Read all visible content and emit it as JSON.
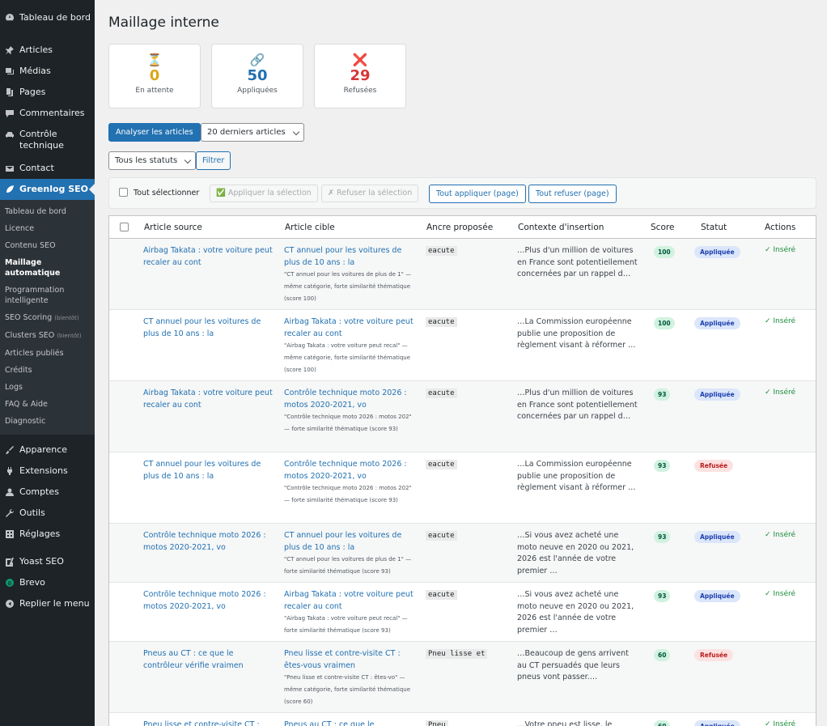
{
  "sidebar": {
    "items_top": [
      {
        "label": "Tableau de bord",
        "icon": "dashboard-icon"
      },
      {
        "label": "Articles",
        "icon": "pin-icon"
      },
      {
        "label": "Médias",
        "icon": "media-icon"
      },
      {
        "label": "Pages",
        "icon": "page-icon"
      },
      {
        "label": "Commentaires",
        "icon": "comment-icon"
      },
      {
        "label": "Contrôle technique",
        "icon": "car-icon"
      },
      {
        "label": "Contact",
        "icon": "mail-icon"
      },
      {
        "label": "Greenlog SEO",
        "icon": "leaf-icon"
      }
    ],
    "submenu": [
      {
        "label": "Tableau de bord",
        "soon": ""
      },
      {
        "label": "Licence",
        "soon": ""
      },
      {
        "label": "Contenu SEO",
        "soon": ""
      },
      {
        "label": "Maillage automatique",
        "soon": ""
      },
      {
        "label": "Programmation intelligente",
        "soon": ""
      },
      {
        "label": "SEO Scoring",
        "soon": "(bientôt)"
      },
      {
        "label": "Clusters SEO",
        "soon": "(bientôt)"
      },
      {
        "label": "Articles publiés",
        "soon": ""
      },
      {
        "label": "Crédits",
        "soon": ""
      },
      {
        "label": "Logs",
        "soon": ""
      },
      {
        "label": "FAQ & Aide",
        "soon": ""
      },
      {
        "label": "Diagnostic",
        "soon": ""
      }
    ],
    "items_bottom": [
      {
        "label": "Apparence",
        "icon": "brush-icon"
      },
      {
        "label": "Extensions",
        "icon": "plugin-icon"
      },
      {
        "label": "Comptes",
        "icon": "user-icon"
      },
      {
        "label": "Outils",
        "icon": "wrench-icon"
      },
      {
        "label": "Réglages",
        "icon": "settings-icon"
      },
      {
        "label": "Yoast SEO",
        "icon": "yoast-icon"
      },
      {
        "label": "Brevo",
        "icon": "brevo-icon"
      },
      {
        "label": "Replier le menu",
        "icon": "collapse-icon"
      }
    ]
  },
  "page": {
    "title": "Maillage interne"
  },
  "stats": [
    {
      "icon": "⏳",
      "value": "0",
      "label": "En attente",
      "color": "#dba617"
    },
    {
      "icon": "🔗",
      "value": "50",
      "label": "Appliquées",
      "color": "#2271b1"
    },
    {
      "icon": "❌",
      "value": "29",
      "label": "Refusées",
      "color": "#d63638"
    }
  ],
  "toolbar": {
    "analyze_label": "Analyser les articles",
    "articles_select": "20 derniers articles",
    "status_select": "Tous les statuts",
    "filter_label": "Filtrer"
  },
  "bulk": {
    "select_all": "Tout sélectionner",
    "apply_selection": "✅ Appliquer la sélection",
    "refuse_selection": "✗ Refuser la sélection",
    "apply_page": "Tout appliquer (page)",
    "refuse_page": "Tout refuser (page)"
  },
  "table": {
    "headers": [
      "Article source",
      "Article cible",
      "Ancre proposée",
      "Contexte d'insertion",
      "Score",
      "Statut",
      "Actions"
    ],
    "rows": [
      {
        "source": "Airbag Takata : votre voiture peut recaler au cont",
        "target": "CT annuel pour les voitures de plus de 10 ans : la",
        "note": "\"CT annuel pour les voitures de plus de 1\" — même catégorie, forte similarité thématique (score 100)",
        "anchor": "eacute",
        "context": "…Plus d'un million de voitures en France sont potentiellement concernées par un rappel d…",
        "score": "100",
        "status": "Appliquée",
        "action": "✓ Inséré"
      },
      {
        "source": "CT annuel pour les voitures de plus de 10 ans : la",
        "target": "Airbag Takata : votre voiture peut recaler au cont",
        "note": "\"Airbag Takata : votre voiture peut recal\" — même catégorie, forte similarité thématique (score 100)",
        "anchor": "eacute",
        "context": "…La Commission européenne publie une proposition de règlement visant à réformer …",
        "score": "100",
        "status": "Appliquée",
        "action": "✓ Inséré"
      },
      {
        "source": "Airbag Takata : votre voiture peut recaler au cont",
        "target": "Contrôle technique moto 2026 : motos 2020-2021, vo",
        "note": "\"Contrôle technique moto 2026 : motos 202\" — forte similarité thématique (score 93)",
        "anchor": "eacute",
        "context": "…Plus d'un million de voitures en France sont potentiellement concernées par un rappel d…",
        "score": "93",
        "status": "Appliquée",
        "action": "✓ Inséré"
      },
      {
        "source": "CT annuel pour les voitures de plus de 10 ans : la",
        "target": "Contrôle technique moto 2026 : motos 2020-2021, vo",
        "note": "\"Contrôle technique moto 2026 : motos 202\" — forte similarité thématique (score 93)",
        "anchor": "eacute",
        "context": "…La Commission européenne publie une proposition de règlement visant à réformer …",
        "score": "93",
        "status": "Refusée",
        "action": ""
      },
      {
        "source": "Contrôle technique moto 2026 : motos 2020-2021, vo",
        "target": "CT annuel pour les voitures de plus de 10 ans : la",
        "note": "\"CT annuel pour les voitures de plus de 1\" — forte similarité thématique (score 93)",
        "anchor": "eacute",
        "context": "…Si vous avez acheté une moto neuve en 2020 ou 2021, 2026 est l'année de votre premier …",
        "score": "93",
        "status": "Appliquée",
        "action": "✓ Inséré"
      },
      {
        "source": "Contrôle technique moto 2026 : motos 2020-2021, vo",
        "target": "Airbag Takata : votre voiture peut recaler au cont",
        "note": "\"Airbag Takata : votre voiture peut recal\" — forte similarité thématique (score 93)",
        "anchor": "eacute",
        "context": "…Si vous avez acheté une moto neuve en 2020 ou 2021, 2026 est l'année de votre premier …",
        "score": "93",
        "status": "Appliquée",
        "action": "✓ Inséré"
      },
      {
        "source": "Pneus au CT : ce que le contrôleur vérifie vraimen",
        "target": "Pneu lisse et contre-visite CT : êtes-vous vraimen",
        "note": "\"Pneu lisse et contre-visite CT : êtes-vo\" — même catégorie, forte similarité thématique (score 60)",
        "anchor": "Pneu lisse et",
        "context": "…Beaucoup de gens arrivent au CT persuadés que leurs pneus vont passer.…",
        "score": "60",
        "status": "Refusée",
        "action": ""
      },
      {
        "source": "Pneu lisse et contre-visite CT : êtes",
        "target": "Pneus au CT : ce que le contrôleur",
        "note": "",
        "anchor": "Pneu",
        "context": "…Votre pneu est lisse, le",
        "score": "60",
        "status": "Appliquée",
        "action": "✓ Inséré"
      }
    ]
  }
}
